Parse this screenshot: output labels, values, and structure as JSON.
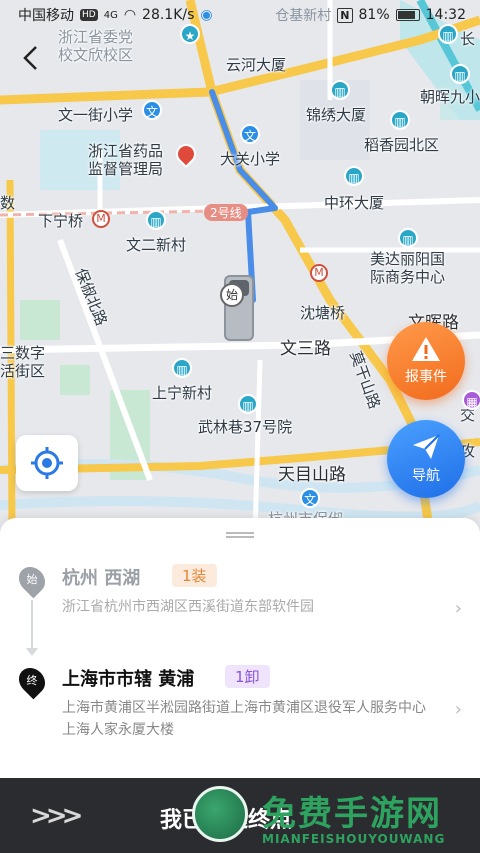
{
  "status_bar": {
    "carrier": "中国移动",
    "hd": "HD",
    "network": "4G",
    "speed": "28.1K/s",
    "location_text": "仓基新村",
    "nfc": "N",
    "battery": "81%",
    "time": "14:32"
  },
  "map": {
    "labels": {
      "l1": "浙江省委党",
      "l2": "校文欣校区",
      "l3": "云河大厦",
      "l4": "长",
      "l5": "文一街小学",
      "l6": "锦绣大厦",
      "l7": "朝晖九小",
      "l8": "浙江省药品",
      "l9": "监督管理局",
      "l10": "稻香园北区",
      "l11": "大关小学",
      "l12": "中环大厦",
      "l13": "下宁桥",
      "l14": "2号线",
      "l15": "文二新村",
      "l16": "美达丽阳国",
      "l17": "际商务中心",
      "l18": "保俶北路",
      "l19": "沈塘桥",
      "l20": "文三路",
      "l21": "三数字",
      "l22": "活街区",
      "l23": "上宁新村",
      "l24": "武林巷37号院",
      "l25": "天目山路",
      "l26": "杭州市保俶",
      "l27": "莫干山路",
      "l28": "交",
      "l29": "文晖路",
      "l30": "攻",
      "l31": "数"
    },
    "start_marker": "始",
    "report_button_label": "报事件",
    "nav_button_label": "导航"
  },
  "sheet": {
    "origin": {
      "pin": "始",
      "name": "杭州 西湖",
      "tag": "1装",
      "address": "浙江省杭州市西湖区西溪街道东部软件园"
    },
    "destination": {
      "pin": "终",
      "name": "上海市市辖 黄浦",
      "tag": "1卸",
      "address": "上海市黄浦区半淞园路街道上海市黄浦区退役军人服务中心上海人家永厦大楼"
    }
  },
  "action_bar": {
    "label": "我已到达终点"
  },
  "watermark": {
    "title": "免费手游网",
    "subtitle": "MIANFEISHOUYOUWANG"
  },
  "colors": {
    "route": "#4a8de8",
    "accent_orange": "#f26b1d",
    "accent_blue": "#1f6fe8"
  }
}
